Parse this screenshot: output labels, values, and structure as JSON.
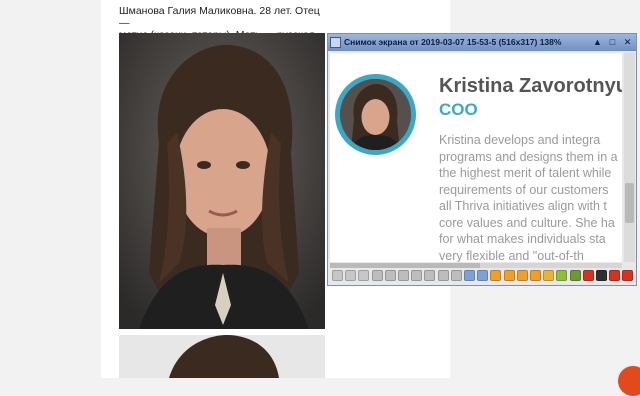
{
  "article": {
    "caption_line1": "Шманова Галия Маликовна. 28 лет. Отец —",
    "caption_line2": "метис (казахи, татары). Мать — русская."
  },
  "viewer": {
    "title": "Снимок экрана от 2019-03-07 15-53-5 (516x317) 138%",
    "title_buttons": [
      "▲",
      "□",
      "✕"
    ],
    "profile": {
      "name": "Kristina Zavorotnyuk",
      "role": "COO",
      "bio_lines": [
        "Kristina develops and integra",
        "programs and designs them in a",
        "the highest merit of talent while",
        "requirements of our customers",
        "all Thriva initiatives align with t",
        "core values and culture. She ha",
        "for what makes individuals sta",
        "very flexible and \"out-of-th"
      ]
    },
    "toolbar_icons": [
      "back-icon",
      "forward-icon",
      "play-icon",
      "rotate-left-icon",
      "rotate-right-icon",
      "flip-icon",
      "mirror-icon",
      "crop-icon",
      "fit-icon",
      "actual-size-icon",
      "zoom-in-icon",
      "zoom-out-icon",
      "undo-icon",
      "redo-icon",
      "swap-icon",
      "sort-icon",
      "open-folder-icon",
      "save-icon",
      "print-icon",
      "delete-icon",
      "info-icon",
      "settings-icon",
      "exit-icon"
    ],
    "accent_color": "#3aa9c6"
  }
}
